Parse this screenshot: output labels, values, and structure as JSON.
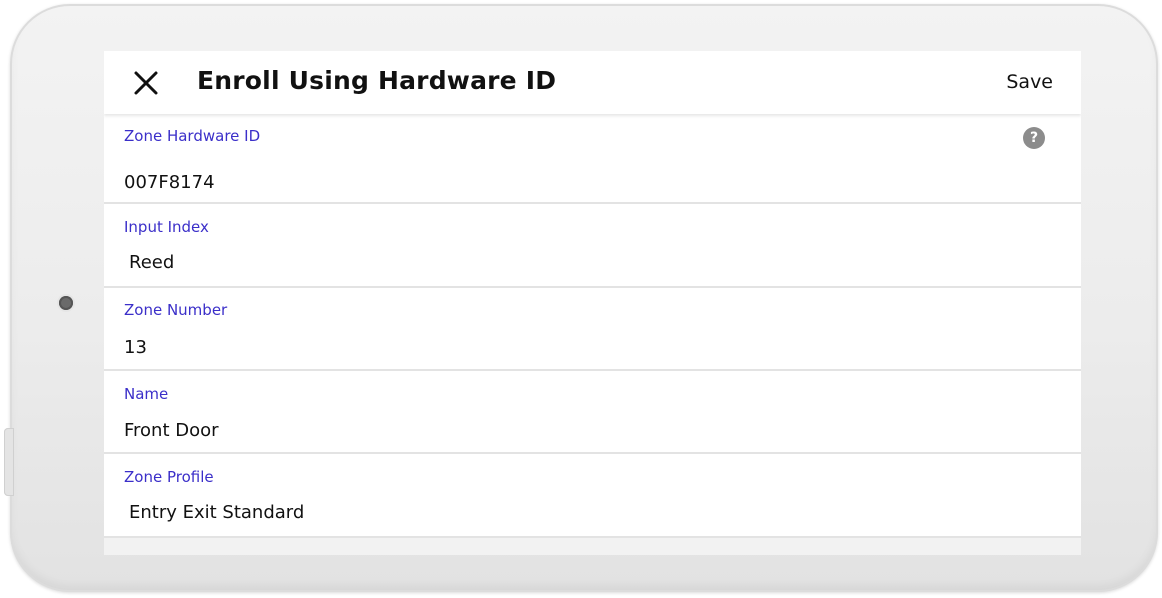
{
  "header": {
    "title": "Enroll Using Hardware ID",
    "save_label": "Save",
    "close_icon": "close-icon"
  },
  "fields": [
    {
      "label": "Zone Hardware ID",
      "value": "007F8174",
      "help_icon": "question-icon",
      "help_glyph": "?"
    },
    {
      "label": "Input Index",
      "value": "Reed"
    },
    {
      "label": "Zone Number",
      "value": "13"
    },
    {
      "label": "Name",
      "value": "Front Door"
    },
    {
      "label": "Zone Profile",
      "value": "Entry Exit Standard"
    }
  ],
  "colors": {
    "label": "#3b2fc9",
    "text": "#111111",
    "screen_background": "#f2f2f2",
    "divider": "#e3e3e3"
  }
}
